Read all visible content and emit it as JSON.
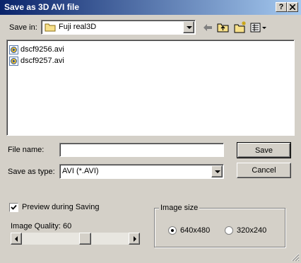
{
  "window": {
    "title": "Save as 3D AVI file",
    "help_button": "?",
    "close_button": "X"
  },
  "save_in": {
    "label": "Save in:",
    "value": "Fuji real3D"
  },
  "toolbar": {
    "back_icon": "back-arrow-icon",
    "up_icon": "up-folder-icon",
    "new_folder_icon": "new-folder-icon",
    "view_menu_icon": "view-menu-icon"
  },
  "files": [
    {
      "name": "dscf9256.avi"
    },
    {
      "name": "dscf9257.avi"
    }
  ],
  "file_name": {
    "label": "File name:",
    "value": ""
  },
  "save_as_type": {
    "label": "Save as type:",
    "value": "AVI (*.AVI)"
  },
  "buttons": {
    "save": "Save",
    "cancel": "Cancel"
  },
  "preview": {
    "label": "Preview during Saving",
    "checked": true
  },
  "image_quality": {
    "label": "Image Quality:",
    "value": "60"
  },
  "image_size": {
    "legend": "Image size",
    "options": [
      {
        "label": "640x480",
        "selected": true
      },
      {
        "label": "320x240",
        "selected": false
      }
    ]
  },
  "colors": {
    "title_start": "#0a246a",
    "title_end": "#a6caf0",
    "face": "#d4d0c8"
  }
}
